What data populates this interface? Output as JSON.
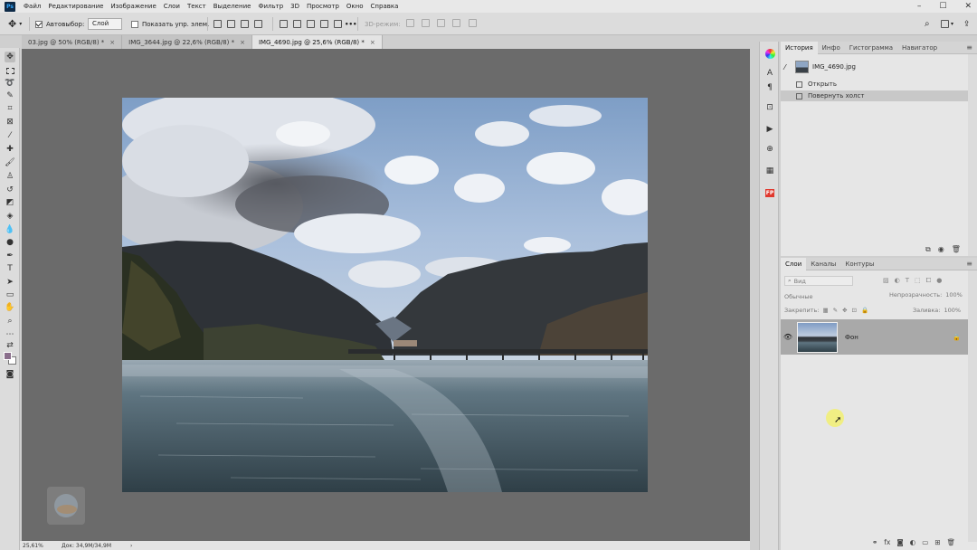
{
  "menubar": {
    "app_logo": "Ps",
    "items": [
      "Файл",
      "Редактирование",
      "Изображение",
      "Слои",
      "Текст",
      "Выделение",
      "Фильтр",
      "3D",
      "Просмотр",
      "Окно",
      "Справка"
    ],
    "window_controls": {
      "minimize": "–",
      "maximize": "☐",
      "close": "✕"
    }
  },
  "options": {
    "autoselect_label": "Автовыбор:",
    "autoselect_checked": true,
    "layer_select_value": "Слой",
    "show_transform_label": "Показать упр. элем.",
    "show_transform_checked": false,
    "mode_3d_label": "3D-режим:",
    "more_glyph": "•••"
  },
  "tabs": [
    {
      "label": "03.jpg @ 50% (RGB/8) *",
      "close": "×",
      "active": false
    },
    {
      "label": "IMG_3644.jpg @ 22,6% (RGB/8) *",
      "close": "×",
      "active": false
    },
    {
      "label": "IMG_4690.jpg @ 25,6% (RGB/8) *",
      "close": "×",
      "active": true
    }
  ],
  "status": {
    "zoom": "25,61%",
    "doc": "Док: 34,9M/34,9M",
    "arrow": "›"
  },
  "history_panel": {
    "tabs": [
      "История",
      "Инфо",
      "Гистограмма",
      "Навигатор"
    ],
    "snapshot_name": "IMG_4690.jpg",
    "steps": [
      {
        "label": "Открыть",
        "selected": false
      },
      {
        "label": "Повернуть холст",
        "selected": true
      }
    ]
  },
  "layers_panel": {
    "tabs": [
      "Слои",
      "Каналы",
      "Контуры"
    ],
    "filter_placeholder": "Вид",
    "blend_mode": "Обычные",
    "opacity_label": "Непрозрачность:",
    "opacity_value": "100%",
    "lock_label": "Закрепить:",
    "fill_label": "Заливка:",
    "fill_value": "100%",
    "layers": [
      {
        "name": "Фон",
        "visible": true,
        "locked": true
      }
    ]
  },
  "colors": {
    "accent_fill": "#a9a9a9",
    "canvas_bg": "#6b6b6b",
    "cursor_highlight": "#f3f06a"
  }
}
